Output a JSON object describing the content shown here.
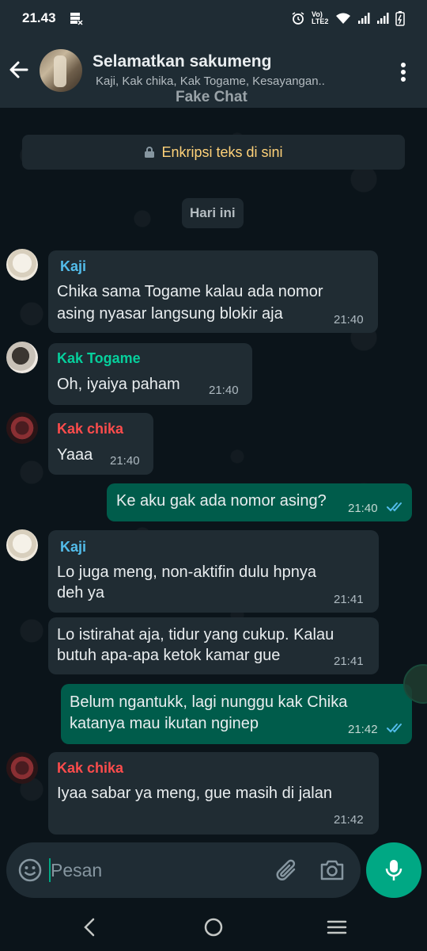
{
  "status_bar": {
    "time": "21.43",
    "volte_label": "Vo) LTE2"
  },
  "header": {
    "title": "Selamatkan sakumeng",
    "members": "Kaji, Kak chika, Kak Togame, Kesayangan..",
    "watermark": "Fake Chat"
  },
  "chat": {
    "encryption_notice": "Enkripsi teks di sini",
    "date_chip": "Hari ini",
    "messages": [
      {
        "sender": "Kaji",
        "sender_color": "#53bdeb",
        "text_line1": "Chika sama Togame kalau ada nomor",
        "text_line2": "asing nyasar langsung blokir aja",
        "time": "21:40"
      },
      {
        "sender": "Kak Togame",
        "sender_color": "#06cf9c",
        "text": "Oh, iyaiya paham",
        "time": "21:40"
      },
      {
        "sender": "Kak chika",
        "sender_color": "#fc4c4c",
        "text": "Yaaa",
        "time": "21:40"
      },
      {
        "text": "Ke aku gak ada nomor asing?",
        "time": "21:40",
        "read": true
      },
      {
        "sender": "Kaji",
        "sender_color": "#53bdeb",
        "text_line1": "Lo juga meng, non-aktifin dulu hpnya",
        "text_line2": "deh ya",
        "time": "21:41"
      },
      {
        "text_line1": "Lo istirahat aja, tidur yang cukup. Kalau",
        "text_line2": "butuh apa-apa ketok kamar gue",
        "time": "21:41"
      },
      {
        "text_line1": "Belum ngantukk, lagi nunggu kak Chika",
        "text_line2": "katanya mau ikutan nginep",
        "time": "21:42",
        "read": true
      },
      {
        "sender": "Kak chika",
        "sender_color": "#fc4c4c",
        "text": "Iyaa sabar ya meng, gue masih di jalan",
        "time": "21:42"
      }
    ]
  },
  "composer": {
    "placeholder": "Pesan"
  },
  "icons": {
    "back": "arrow-left-icon",
    "menu": "three-dots-vertical-icon",
    "lock": "lock-icon",
    "emoji": "emoji-icon",
    "attach": "paperclip-icon",
    "camera": "camera-icon",
    "mic": "microphone-icon"
  },
  "colors": {
    "background": "#0b141a",
    "header": "#1f2c34",
    "incoming_bubble": "#202c33",
    "outgoing_bubble": "#005c4b",
    "accent": "#00a884",
    "read_ticks": "#53bdeb"
  }
}
